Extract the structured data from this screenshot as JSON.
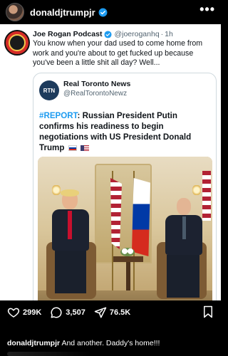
{
  "post": {
    "username": "donaldjtrumpjr",
    "more_label": "•••"
  },
  "tweet": {
    "name": "Joe Rogan Podcast",
    "handle": "@joeroganhq",
    "time": "1h",
    "text": "You know when your dad used to come home from work and you're about to get fucked up because you've been a little shit all day? Well..."
  },
  "quote": {
    "avatar_text": "RTN",
    "name": "Real Toronto News",
    "handle": "@RealTorontoNewz",
    "hashtag": "#REPORT",
    "text": ": Russian President Putin confirms his readiness to begin negotiations with US President Donald Trump"
  },
  "actions": {
    "likes": "299K",
    "comments": "3,507",
    "shares": "76.5K"
  },
  "caption": {
    "username": "donaldjtrumpjr",
    "text": "And another. Daddy's home!!!"
  },
  "colors": {
    "verified": "#1d9bf0",
    "hashtag": "#1d9bf0"
  }
}
